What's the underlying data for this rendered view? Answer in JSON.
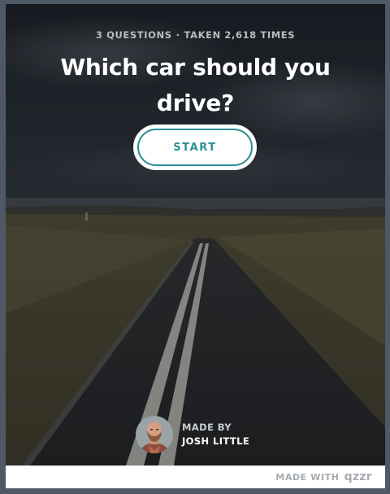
{
  "quiz": {
    "question_count": "3 QUESTIONS",
    "separator": "·",
    "taken_count": "TAKEN 2,618 TIMES",
    "title": "Which car should you drive?",
    "start_label": "START"
  },
  "author": {
    "label": "MADE BY",
    "name": "JOSH LITTLE"
  },
  "footer": {
    "made_with": "MADE WITH",
    "brand": "qzzr"
  },
  "colors": {
    "accent": "#2d8f93",
    "footer_text": "#a7acb2"
  },
  "icons": {
    "avatar": "author-avatar-photo",
    "brand": "qzzr-logo"
  }
}
